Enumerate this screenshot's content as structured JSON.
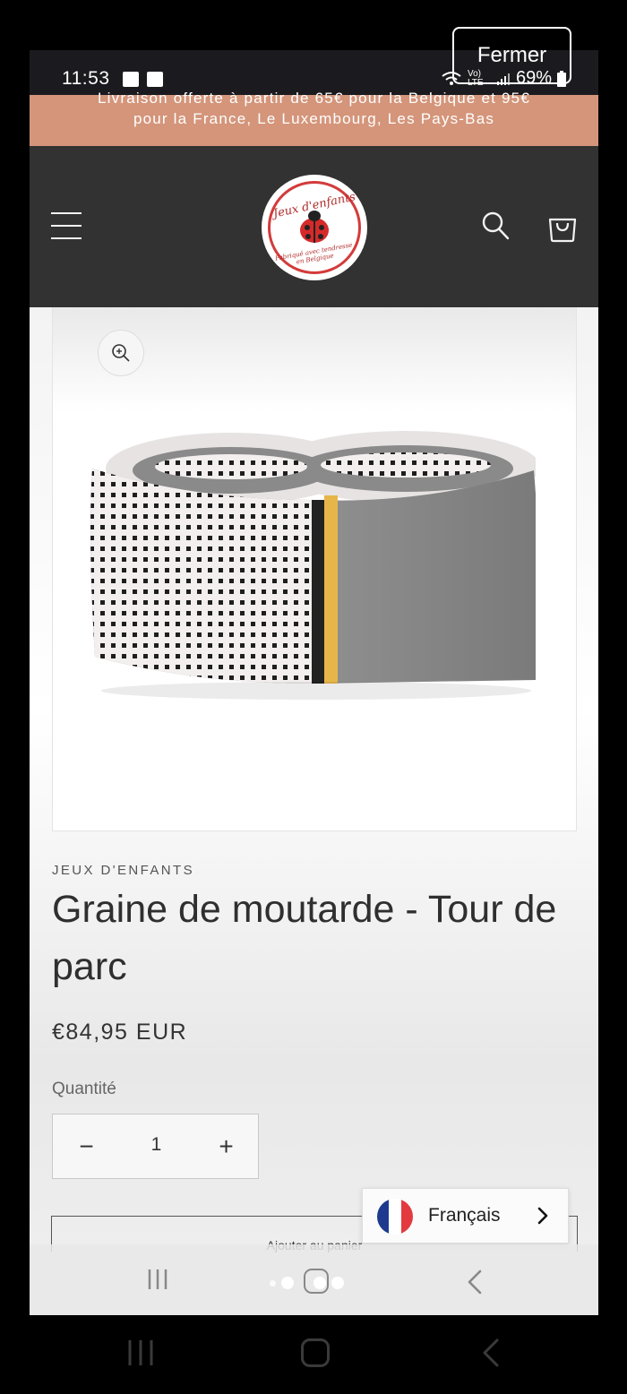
{
  "status_bar": {
    "time": "11:53",
    "battery": "69%",
    "network": "Vo) LTE"
  },
  "announcement": {
    "line1": "Livraison offerte à partir de 65€ pour la Belgique et 95€",
    "line2": "pour la France, Le Luxembourg, Les Pays-Bas"
  },
  "overlay": {
    "close_label": "Fermer"
  },
  "header": {
    "logo_script": "Jeux d'enfants",
    "logo_tagline": "Fabriqué avec tendresse en Belgique"
  },
  "product": {
    "vendor": "JEUX D'ENFANTS",
    "title": "Graine de moutarde - Tour de parc",
    "price": "€84,95 EUR",
    "quantity_label": "Quantité",
    "quantity_value": "1",
    "quantity_minus": "−",
    "quantity_plus": "+",
    "add_to_cart": "Ajouter au panier"
  },
  "language": {
    "label": "Français"
  },
  "colors": {
    "announcement_bg": "#d4957a",
    "header_bg": "#323232",
    "mustard_stripe": "#e7b64a",
    "bumper_grey": "#8b8b8b"
  },
  "icons": [
    "image-icon",
    "check-square-icon",
    "wifi-icon",
    "signal-icon",
    "battery-icon",
    "menu-icon",
    "search-icon",
    "cart-icon",
    "zoom-in-icon",
    "flag-fr-icon",
    "chevron-right-icon",
    "recents-icon",
    "home-icon",
    "back-icon"
  ]
}
